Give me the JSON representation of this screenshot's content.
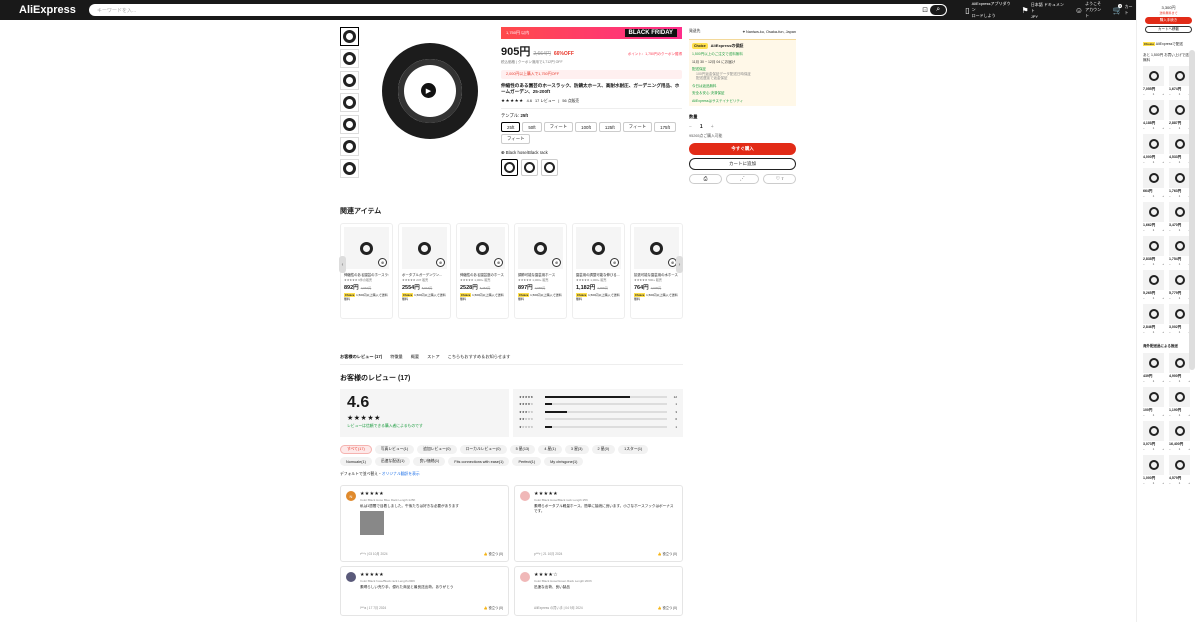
{
  "header": {
    "logo": "AliExpress",
    "search_placeholder": "キーワードを入...",
    "links": [
      {
        "icon": "phone-icon",
        "line1": "AliExpressアプリダウン",
        "line2": "ロードしよう"
      },
      {
        "icon": "flag-icon",
        "line1": "日本語 ドキュメント",
        "line2": "JPY"
      },
      {
        "icon": "user-icon",
        "line1": "ようこそ",
        "line2": "アカウント"
      }
    ],
    "cart_label": "カート",
    "cart_count": "0"
  },
  "product": {
    "promo_banner_left": "1,750円 以内",
    "promo_banner_right": "BLACK FRIDAY",
    "price": "905円",
    "old_price": "2,664円",
    "discount": "66%OFF",
    "price_note": "ポイント：1,750円のクーポン獲得",
    "tax_note": "税込価格 | クーポン適用で1,712円 OFF",
    "coupon": "2,000円以上購入で1,750円OFF",
    "title": "伸縮性のある園芸のホースラック、防錆太ホース、高耐水耐圧、ガーデニング用品、ホームガーデン、25-200ft",
    "rating": "4.6",
    "reviews": "17 レビュー",
    "sold": "56 点販売",
    "option_label": "テンプル: ",
    "option_value": "25ft",
    "options": [
      "25ft",
      "50ft",
      "フィート",
      "100ft",
      "125ft",
      "フィート",
      "175ft",
      "フィート"
    ],
    "color_label": "Black hose/Black rack",
    "thumb_count": 7
  },
  "buybox": {
    "ship_to_label": "発送先",
    "ship_to": "Naniwa-ku, Osaka-fun, Japan",
    "choice_badge": "Choice",
    "choice_title": "AliExpressの保証",
    "lines": [
      {
        "text": "1,500円以上のご注文で送料無料",
        "cls": "green"
      },
      {
        "text": "11月 30 ~ 12月 04 にお届け",
        "cls": ""
      },
      {
        "text": "配送保証",
        "cls": "green"
      },
      {
        "text": "100円返金保証データ配送日時保証",
        "cls": "sub"
      },
      {
        "text": "配送遅延で返金保証",
        "cls": "sub"
      },
      {
        "text": "今日は返品無料",
        "cls": "green"
      },
      {
        "text": "安全＆安心 決済保証",
        "cls": "green"
      },
      {
        "text": "AliExpressはサステイナビリティ",
        "cls": "green"
      }
    ],
    "qty_label": "数量",
    "qty": "1",
    "available": "95265点ご購入可能",
    "buy_now": "今すぐ購入",
    "add_cart": "カートに追加",
    "like_count": "7"
  },
  "related": {
    "title": "関連アイテム",
    "items": [
      {
        "title": "伸縮性のある園芸のホースラック",
        "stars": "★★★★★ 6件の販売",
        "price": "892円",
        "old": "2,664円",
        "ship": "1,500円以上購入で送料無料"
      },
      {
        "title": "ポータブルガーデンワン...",
        "stars": "★★★★★ 237 販売",
        "price": "2554円",
        "old": "5,616円",
        "ship": "1,500円以上購入で送料無料"
      },
      {
        "title": "伸縮性のある園芸庭のホース",
        "stars": "★★★★★ 1,000+ 販売",
        "price": "2528円",
        "old": "5,254円",
        "ship": "1,500円以上購入で送料無料"
      },
      {
        "title": "調節可能な園芸用ホース",
        "stars": "★★★★★ 1,000+ 販売",
        "price": "897円",
        "old": "2,655円",
        "ship": "1,500円以上購入で送料無料"
      },
      {
        "title": "園芸用の調整可能な伸びる...",
        "stars": "★★★★★ 1,000+ 販売",
        "price": "1,182円",
        "old": "2,905円",
        "ship": "1,500円以上購入で送料無料"
      },
      {
        "title": "拡張可能な園芸用の水ホース",
        "stars": "★★★★★ 500+ 販売",
        "price": "764円",
        "old": "2,905円",
        "ship": "1,500円以上購入で送料無料"
      }
    ]
  },
  "tabs": [
    "お客様のレビュー (17)",
    "特徴量",
    "概要",
    "ストア",
    "こちらもおすすめ＆お知らせます"
  ],
  "reviews": {
    "title": "お客様のレビュー (17)",
    "score": "4.6",
    "stars": "★★★★★",
    "link": "レビューは信頼できる購入者によるものです",
    "bars": [
      {
        "stars": "★★★★★",
        "count": "12",
        "frac": 0.7
      },
      {
        "stars": "★★★★☆",
        "count": "1",
        "frac": 0.06
      },
      {
        "stars": "★★★☆☆",
        "count": "3",
        "frac": 0.18
      },
      {
        "stars": "★★☆☆☆",
        "count": "0",
        "frac": 0.0
      },
      {
        "stars": "★☆☆☆☆",
        "count": "1",
        "frac": 0.06
      }
    ],
    "filters": [
      "すべて(17)",
      "写真レビュー(1)",
      "追加レビュー(0)",
      "ローカルレビュー(0)",
      "5 星(13)",
      "4 星(1)",
      "3 星(3)",
      "2 星(0)",
      "1スター(1)",
      "Nomuale(1)",
      "迅速な配送(1)",
      "良い価格(1)",
      "Fits connections with ease(1)",
      "Perfect(1)",
      "My chrisgone(1)"
    ],
    "sort_text": "デフォルトで並べ替え・",
    "sort_link": "オリジナル翻訳を表示",
    "cards": [
      {
        "avatar": "N",
        "color": "#e08a2c",
        "stars": "★★★★★",
        "meta": "Color:Black Hose Blue Rack Length:125ft",
        "text": "私は1週間で目着しました。午後たちは好きな必要があります",
        "has_pic": true,
        "date": "r***r | 03 10月 2024",
        "helpful": "役立つ (0)"
      },
      {
        "avatar": "",
        "color": "#f0b8b8",
        "stars": "★★★★★",
        "meta": "Color:Black Hose/Black rack Length:25ft",
        "text": "素晴らポータブル軽量ホース。簡単に接続に良います。小さなホースフックはボーナスです。",
        "has_pic": false,
        "date": "p***r | 21 10月 2024",
        "helpful": "役立つ (0)"
      },
      {
        "avatar": "",
        "color": "#5a5a7a",
        "stars": "★★★★★",
        "meta": "Color:Black hose/Black rack Length:200ft",
        "text": "素晴らしい売り手、優れた商品と最良送出荷。ありがとう",
        "has_pic": false,
        "date": "l***a | 17 7月 2024",
        "helpful": "役立つ (0)"
      },
      {
        "avatar": "",
        "color": "#f0b8b8",
        "stars": "★★★★☆",
        "meta": "Color:Black Hose/Green Rack Length:200ft",
        "text": "迅速な出荷、良い製品",
        "has_pic": false,
        "date": "AliExpress の買い手 | 04 9月 2024",
        "helpful": "役立つ (0)"
      }
    ]
  },
  "sidebar": {
    "amount": "3,300円",
    "hint": "送料無料まで",
    "btn1": "購入手続き",
    "btn2": "カートへ移動",
    "choice_label": "AliExpressで配送",
    "promo": "あと 1,500円 お買い上げで送料無料",
    "items": [
      {
        "price": "7,055円",
        "qty": "1"
      },
      {
        "price": "1,674円",
        "qty": "1"
      },
      {
        "price": "4,188円",
        "qty": "1"
      },
      {
        "price": "2,887円",
        "qty": "1"
      },
      {
        "price": "4,000円",
        "qty": "1"
      },
      {
        "price": "4,533円",
        "qty": "1"
      },
      {
        "price": "664円",
        "qty": "1"
      },
      {
        "price": "1,763円",
        "qty": "1"
      },
      {
        "price": "1,662円",
        "qty": "1"
      },
      {
        "price": "3,470円",
        "qty": "1"
      },
      {
        "price": "2,838円",
        "qty": "1"
      },
      {
        "price": "1,754円",
        "qty": "1"
      },
      {
        "price": "5,265円",
        "qty": "1"
      },
      {
        "price": "5,779円",
        "qty": "1"
      },
      {
        "price": "2,846円",
        "qty": "1"
      },
      {
        "price": "3,002円",
        "qty": "1"
      }
    ],
    "section2": "海外配送品による推送",
    "items2": [
      {
        "price": "439円",
        "qty": "1"
      },
      {
        "price": "4,900円",
        "qty": "1"
      },
      {
        "price": "100円",
        "qty": "1"
      },
      {
        "price": "1,190円",
        "qty": "1"
      },
      {
        "price": "3,073円",
        "qty": "1"
      },
      {
        "price": "16,400円",
        "qty": "1"
      },
      {
        "price": "1,000円",
        "qty": "1"
      },
      {
        "price": "4,579円",
        "qty": "1"
      }
    ]
  }
}
